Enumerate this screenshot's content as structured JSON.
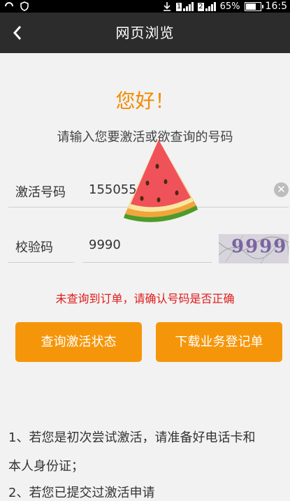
{
  "status": {
    "signal1": "1",
    "signal2": "2",
    "battery": "65%",
    "time": "16:5"
  },
  "header": {
    "back_icon": "chevron-left-icon",
    "title": "网页浏览"
  },
  "main": {
    "greeting": "您好！",
    "prompt": "请输入您要激活或欲查询的号码",
    "activation": {
      "label": "激活号码",
      "value": "155055"
    },
    "verify": {
      "label": "校验码",
      "value": "9990",
      "captcha": "9999"
    },
    "error": "未查询到订单，请确认号码是否正确",
    "buttons": {
      "query": "查询激活状态",
      "download": "下载业务登记单"
    },
    "instructions": [
      "1、若您是初次尝试激活，请准备好电话卡和",
      "本人身份证；",
      "2、若您已提交过激活申请"
    ]
  },
  "colors": {
    "accent": "#f5960a",
    "error": "#e01b1b",
    "navbar": "#2c2c2c"
  }
}
